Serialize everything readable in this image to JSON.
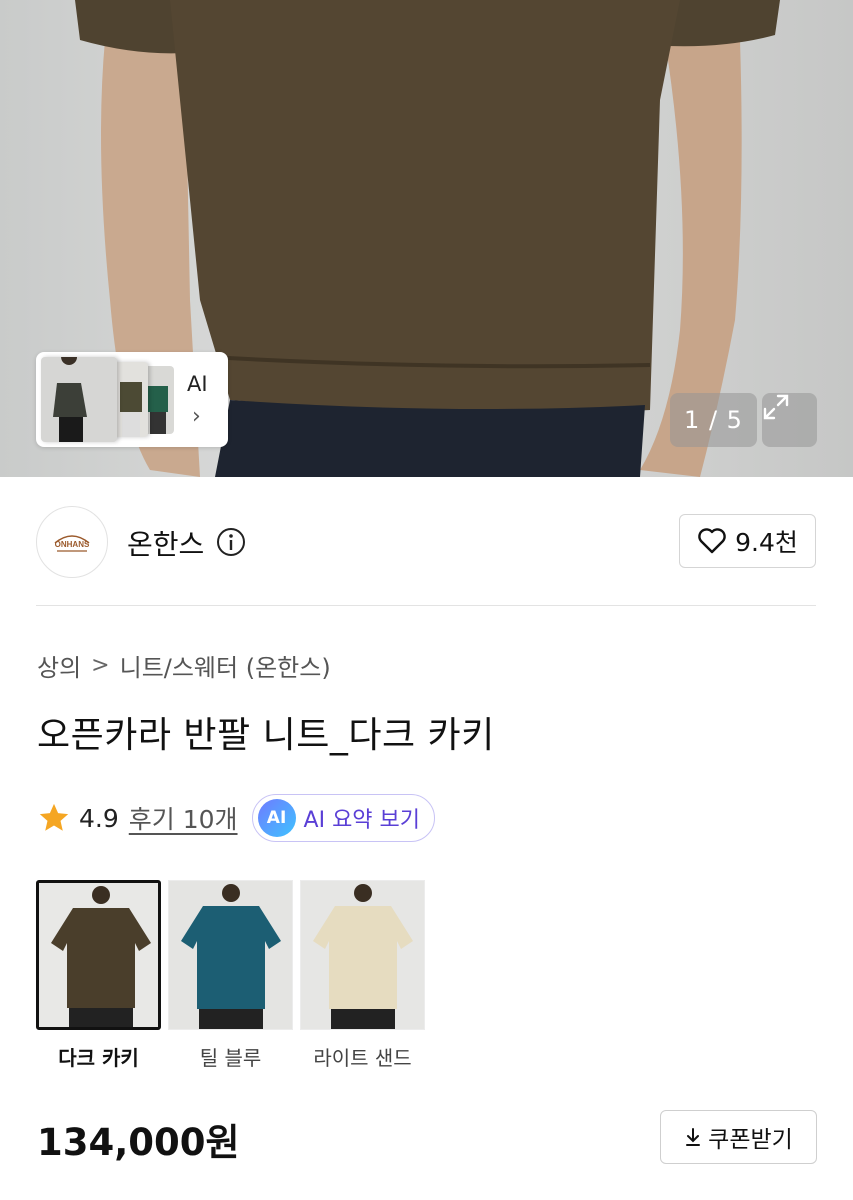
{
  "gallery": {
    "counter": "1 / 5",
    "ai_label": "AI",
    "ai_chevron": "›"
  },
  "brand": {
    "name": "온한스",
    "logo_text": "ONHANS",
    "likes": "9.4천"
  },
  "breadcrumb": {
    "category": "상의",
    "separator": ">",
    "subcategory": "니트/스웨터 (온한스)"
  },
  "product": {
    "title": "오픈카라 반팔 니트_다크 카키",
    "rating": "4.9",
    "reviews": "후기 10개",
    "ai_badge": "AI",
    "ai_summary": "AI 요약 보기",
    "price": "134,000원"
  },
  "colors": [
    {
      "label": "다크 카키",
      "hex": "#4a3e2b",
      "selected": true
    },
    {
      "label": "틸 블루",
      "hex": "#1c5e73",
      "selected": false
    },
    {
      "label": "라이트 샌드",
      "hex": "#e6dcc0",
      "selected": false
    }
  ],
  "coupon": {
    "label": "쿠폰받기",
    "icon": "download-icon"
  },
  "theme": {
    "star": "#f5a623",
    "ai_accent": "#5a3fd6"
  }
}
